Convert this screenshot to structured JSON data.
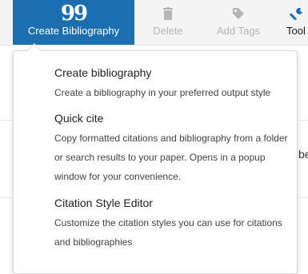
{
  "toolbar": {
    "create_bibliography": {
      "label": "Create Bibliography",
      "icon": "quote-icon",
      "glyph": "99"
    },
    "delete": {
      "label": "Delete",
      "icon": "trash-icon"
    },
    "add_tags": {
      "label": "Add Tags",
      "icon": "tag-icon"
    },
    "tools": {
      "label": "Tool",
      "icon": "wrench-icon"
    }
  },
  "background": {
    "fragment": "be"
  },
  "menu": {
    "items": [
      {
        "title": "Create bibliography",
        "description": "Create a bibliography in your preferred output style"
      },
      {
        "title": "Quick cite",
        "description": "Copy formatted citations and bibliography from a folder or search results to your paper. Opens in a popup window for your convenience."
      },
      {
        "title": "Citation Style Editor",
        "description": "Customize the citation styles you can use for citations and bibliographies"
      }
    ]
  },
  "colors": {
    "accent": "#1b6fb1",
    "disabled": "#b5b5b5",
    "text": "#222222"
  }
}
